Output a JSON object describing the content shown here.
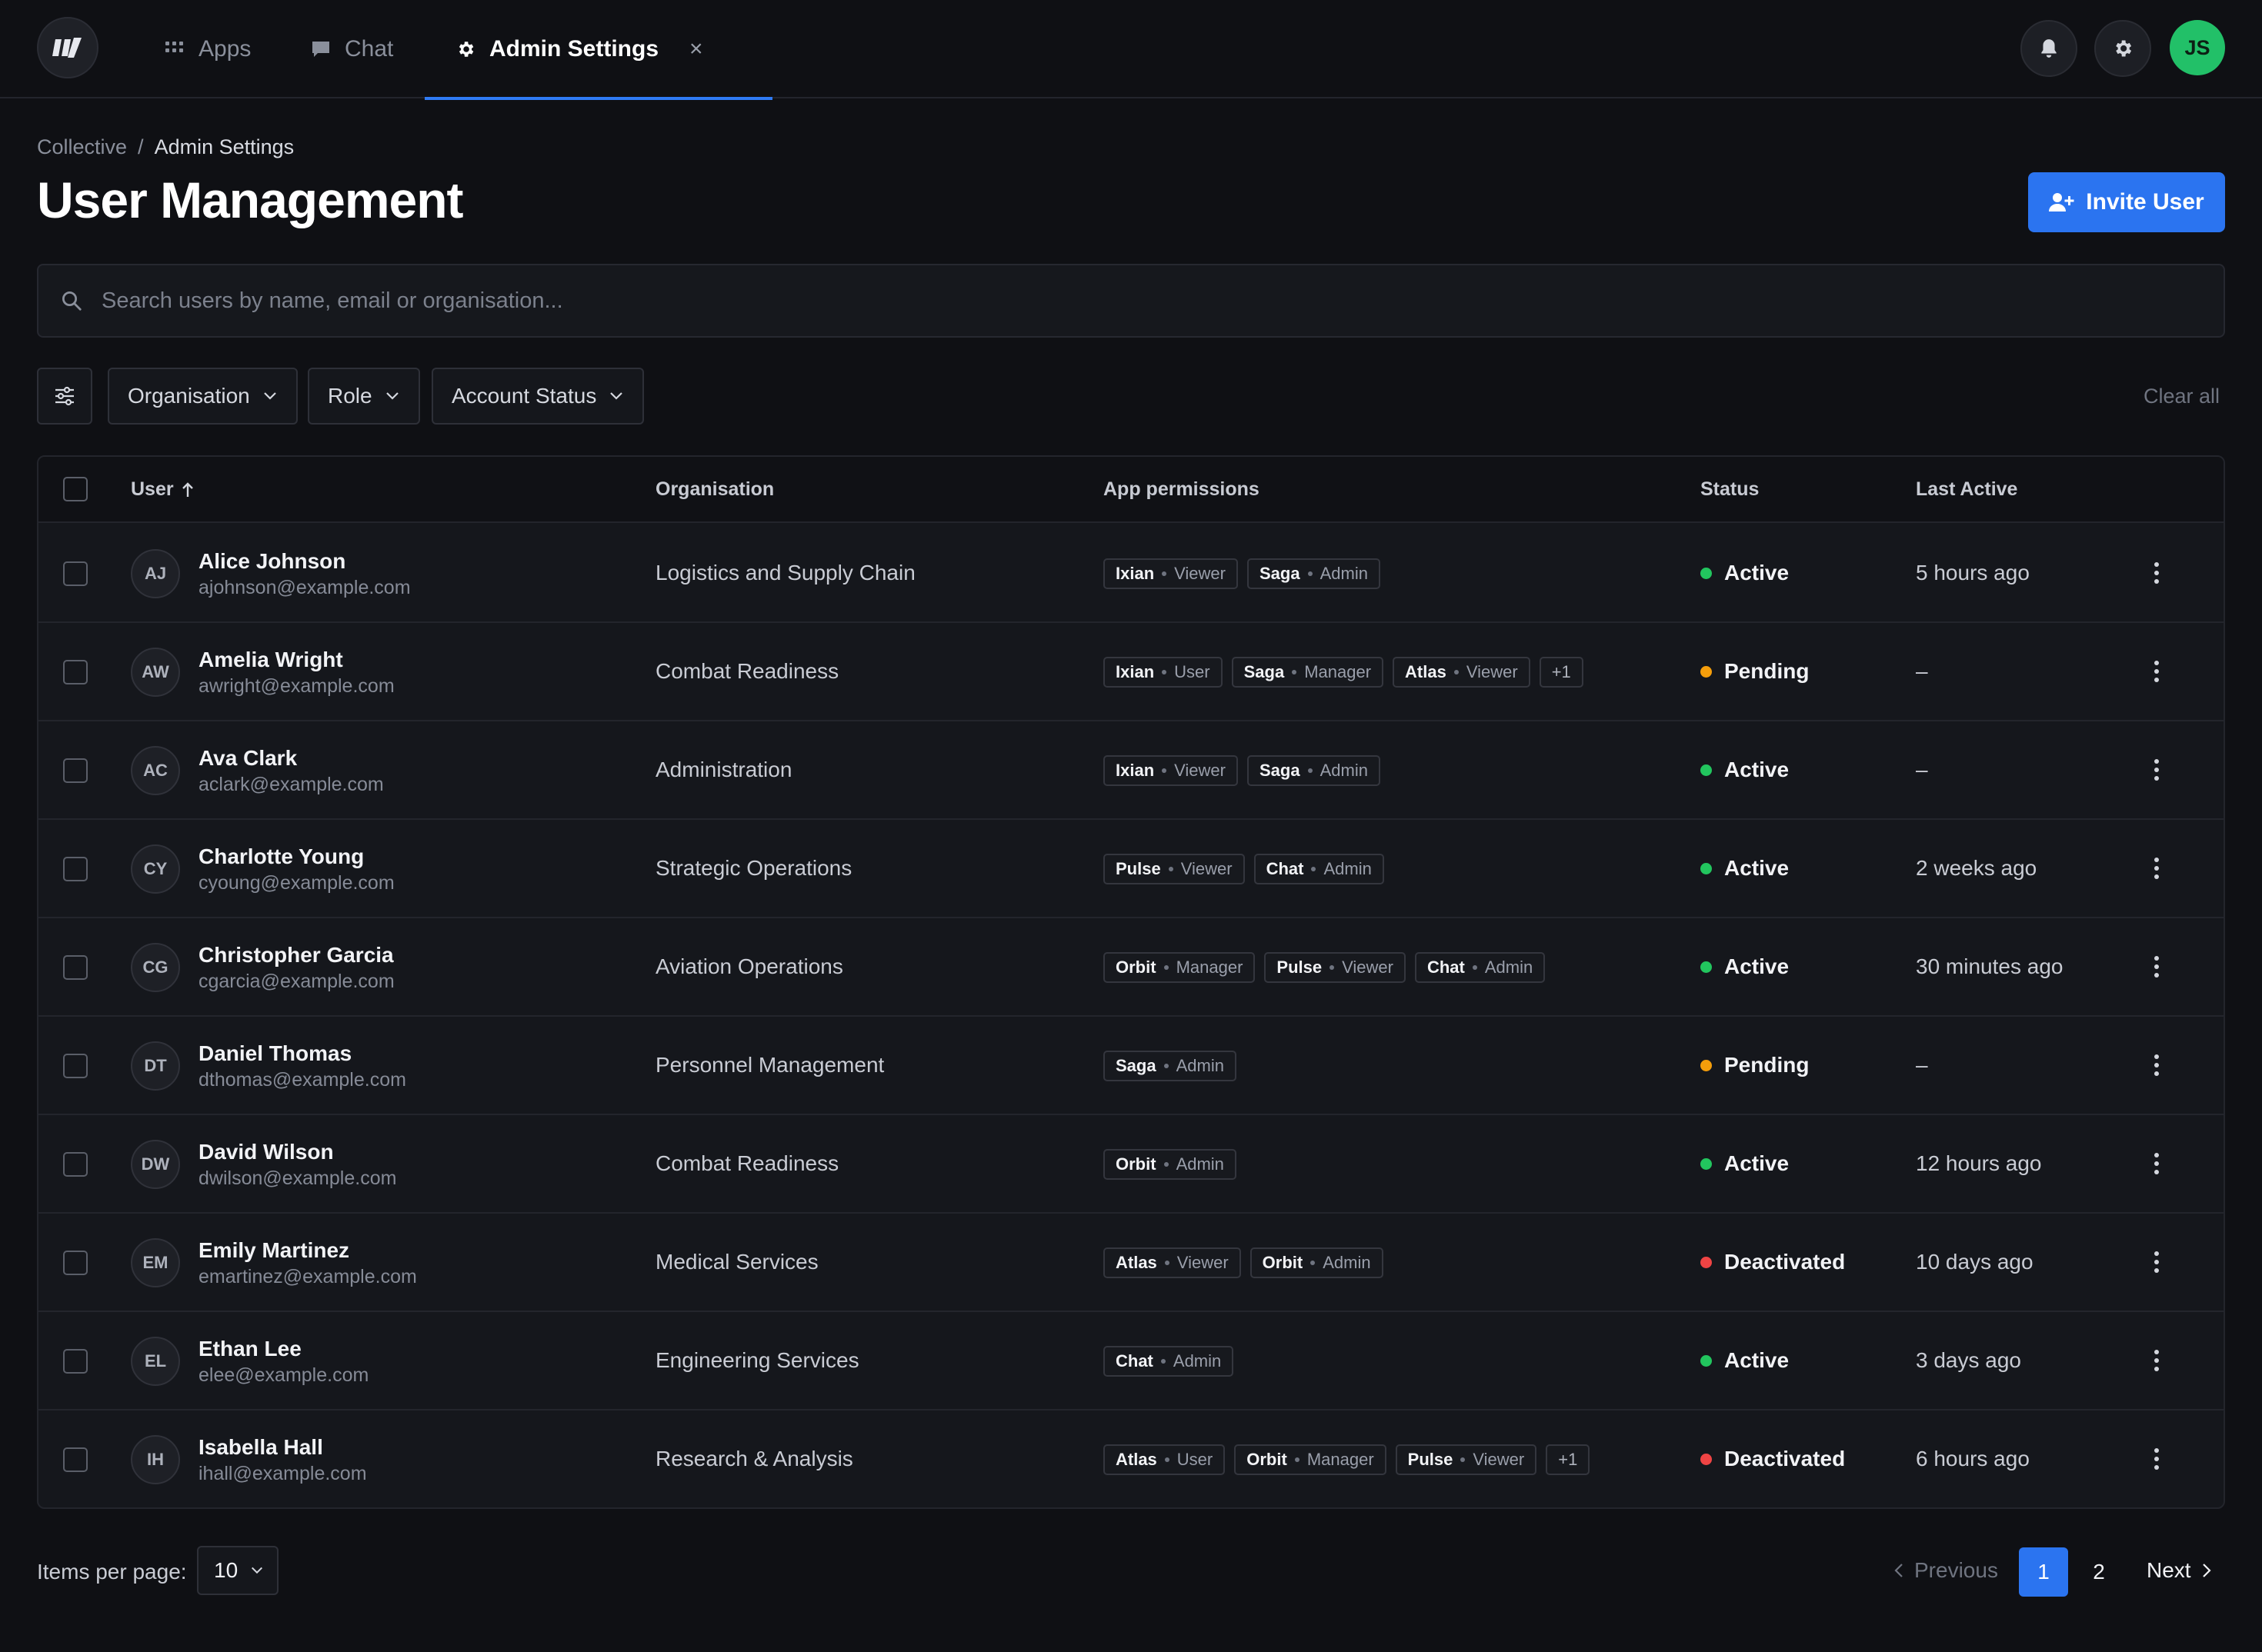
{
  "nav": {
    "tabs": [
      {
        "label": "Apps",
        "icon": "grid-icon"
      },
      {
        "label": "Chat",
        "icon": "chat-bubble-icon"
      },
      {
        "label": "Admin Settings",
        "icon": "gear-icon",
        "active": true
      }
    ],
    "close_symbol": "×",
    "avatar_initials": "JS"
  },
  "breadcrumb": {
    "root": "Collective",
    "separator": "/",
    "current": "Admin Settings"
  },
  "page": {
    "title": "User Management",
    "invite_label": "Invite User"
  },
  "search": {
    "placeholder": "Search users by name, email or organisation..."
  },
  "filters": {
    "organisation": "Organisation",
    "role": "Role",
    "status": "Account Status",
    "clear": "Clear all"
  },
  "table": {
    "headers": {
      "user": "User",
      "organisation": "Organisation",
      "permissions": "App permissions",
      "status": "Status",
      "last_active": "Last Active"
    },
    "rows": [
      {
        "initials": "AJ",
        "name": "Alice Johnson",
        "email": "ajohnson@example.com",
        "org": "Logistics and Supply Chain",
        "perms": [
          [
            "Ixian",
            "Viewer"
          ],
          [
            "Saga",
            "Admin"
          ]
        ],
        "more": "",
        "status": "Active",
        "last": "5 hours ago"
      },
      {
        "initials": "AW",
        "name": "Amelia Wright",
        "email": "awright@example.com",
        "org": "Combat Readiness",
        "perms": [
          [
            "Ixian",
            "User"
          ],
          [
            "Saga",
            "Manager"
          ],
          [
            "Atlas",
            "Viewer"
          ]
        ],
        "more": "+1",
        "status": "Pending",
        "last": "–"
      },
      {
        "initials": "AC",
        "name": "Ava Clark",
        "email": "aclark@example.com",
        "org": "Administration",
        "perms": [
          [
            "Ixian",
            "Viewer"
          ],
          [
            "Saga",
            "Admin"
          ]
        ],
        "more": "",
        "status": "Active",
        "last": "–"
      },
      {
        "initials": "CY",
        "name": "Charlotte Young",
        "email": "cyoung@example.com",
        "org": "Strategic Operations",
        "perms": [
          [
            "Pulse",
            "Viewer"
          ],
          [
            "Chat",
            "Admin"
          ]
        ],
        "more": "",
        "status": "Active",
        "last": "2 weeks ago"
      },
      {
        "initials": "CG",
        "name": "Christopher Garcia",
        "email": "cgarcia@example.com",
        "org": "Aviation Operations",
        "perms": [
          [
            "Orbit",
            "Manager"
          ],
          [
            "Pulse",
            "Viewer"
          ],
          [
            "Chat",
            "Admin"
          ]
        ],
        "more": "",
        "status": "Active",
        "last": "30 minutes ago"
      },
      {
        "initials": "DT",
        "name": "Daniel Thomas",
        "email": "dthomas@example.com",
        "org": "Personnel Management",
        "perms": [
          [
            "Saga",
            "Admin"
          ]
        ],
        "more": "",
        "status": "Pending",
        "last": "–"
      },
      {
        "initials": "DW",
        "name": "David Wilson",
        "email": "dwilson@example.com",
        "org": "Combat Readiness",
        "perms": [
          [
            "Orbit",
            "Admin"
          ]
        ],
        "more": "",
        "status": "Active",
        "last": "12 hours ago"
      },
      {
        "initials": "EM",
        "name": "Emily Martinez",
        "email": "emartinez@example.com",
        "org": "Medical Services",
        "perms": [
          [
            "Atlas",
            "Viewer"
          ],
          [
            "Orbit",
            "Admin"
          ]
        ],
        "more": "",
        "status": "Deactivated",
        "last": "10 days ago"
      },
      {
        "initials": "EL",
        "name": "Ethan Lee",
        "email": "elee@example.com",
        "org": "Engineering Services",
        "perms": [
          [
            "Chat",
            "Admin"
          ]
        ],
        "more": "",
        "status": "Active",
        "last": "3 days ago"
      },
      {
        "initials": "IH",
        "name": "Isabella Hall",
        "email": "ihall@example.com",
        "org": "Research & Analysis",
        "perms": [
          [
            "Atlas",
            "User"
          ],
          [
            "Orbit",
            "Manager"
          ],
          [
            "Pulse",
            "Viewer"
          ]
        ],
        "more": "+1",
        "status": "Deactivated",
        "last": "6 hours ago"
      }
    ]
  },
  "status_colors": {
    "Active": "#22c55e",
    "Pending": "#f59e0b",
    "Deactivated": "#ef4444"
  },
  "colors": {
    "accent": "#2b74f0",
    "avatar": "#22c068"
  },
  "footer": {
    "items_per_page_label": "Items per page:",
    "items_per_page": "10",
    "previous": "Previous",
    "pages": [
      "1",
      "2"
    ],
    "current_page": "1",
    "next": "Next"
  }
}
